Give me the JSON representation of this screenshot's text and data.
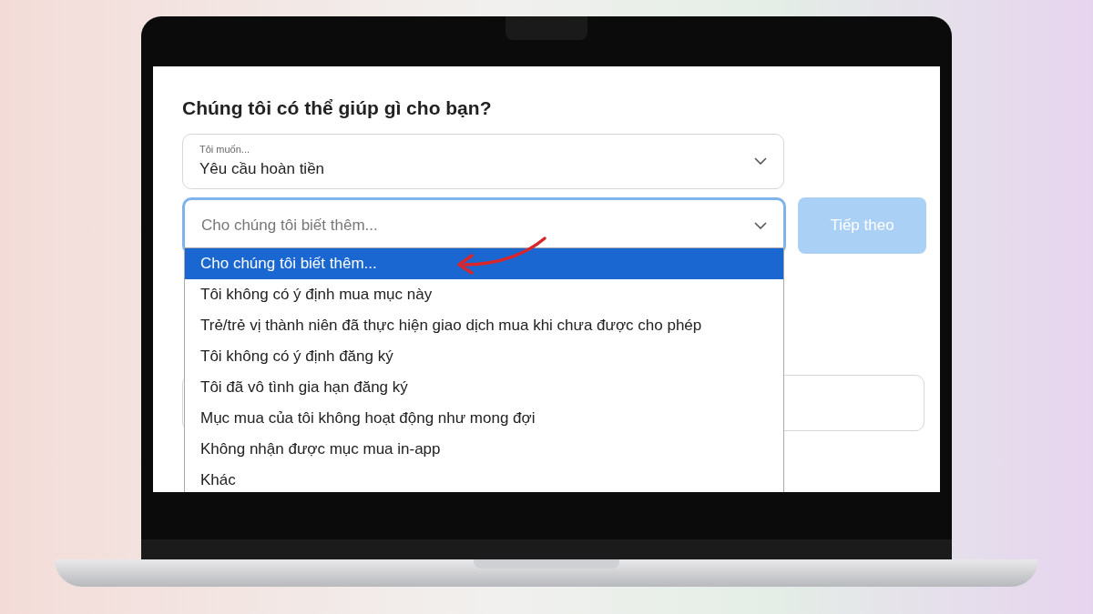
{
  "heading": "Chúng tôi có thể giúp gì cho bạn?",
  "request_field": {
    "label": "Tôi muốn...",
    "value": "Yêu cầu hoàn tiền"
  },
  "reason_field": {
    "placeholder": "Cho chúng tôi biết thêm...",
    "focused": true
  },
  "next_button": {
    "label": "Tiếp theo",
    "disabled": true
  },
  "dropdown_options": [
    {
      "label": "Cho chúng tôi biết thêm...",
      "selected": true
    },
    {
      "label": "Tôi không có ý định mua mục này",
      "selected": false
    },
    {
      "label": "Trẻ/trẻ vị thành niên đã thực hiện giao dịch mua khi chưa được cho phép",
      "selected": false
    },
    {
      "label": "Tôi không có ý định đăng ký",
      "selected": false
    },
    {
      "label": "Tôi đã vô tình gia hạn đăng ký",
      "selected": false
    },
    {
      "label": "Mục mua của tôi không hoạt động như mong đợi",
      "selected": false
    },
    {
      "label": "Không nhận được mục mua in-app",
      "selected": false
    },
    {
      "label": "Khác",
      "selected": false
    }
  ]
}
